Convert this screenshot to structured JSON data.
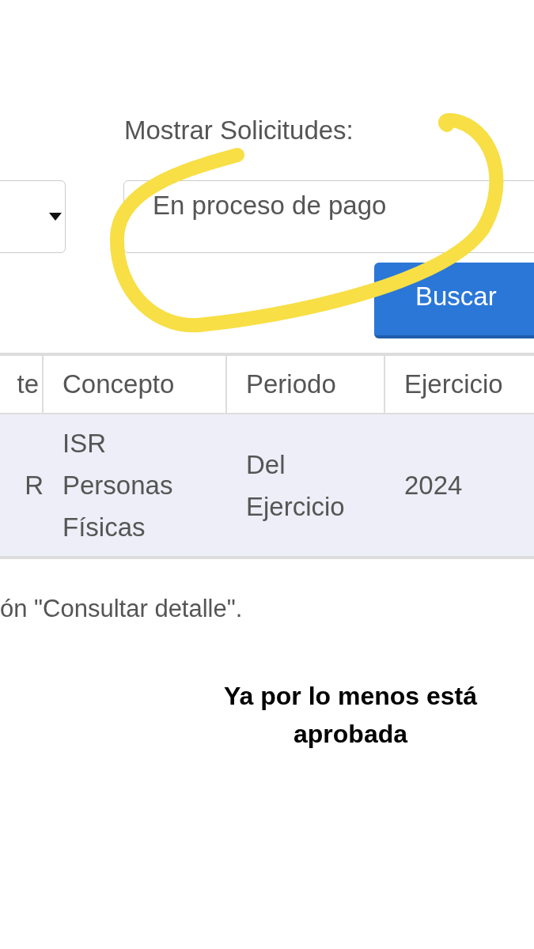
{
  "filter": {
    "label": "Mostrar Solicitudes:",
    "value": "En proceso de pago"
  },
  "search_button": "Buscar",
  "table": {
    "columns": [
      "te",
      "Concepto",
      "Periodo",
      "Ejercicio"
    ],
    "rows": [
      {
        "cells": [
          "R",
          "ISR Personas Físicas",
          "Del Ejercicio",
          "2024"
        ]
      }
    ]
  },
  "note": "ón \"Consultar detalle\".",
  "caption": "Ya por lo menos está aprobada"
}
